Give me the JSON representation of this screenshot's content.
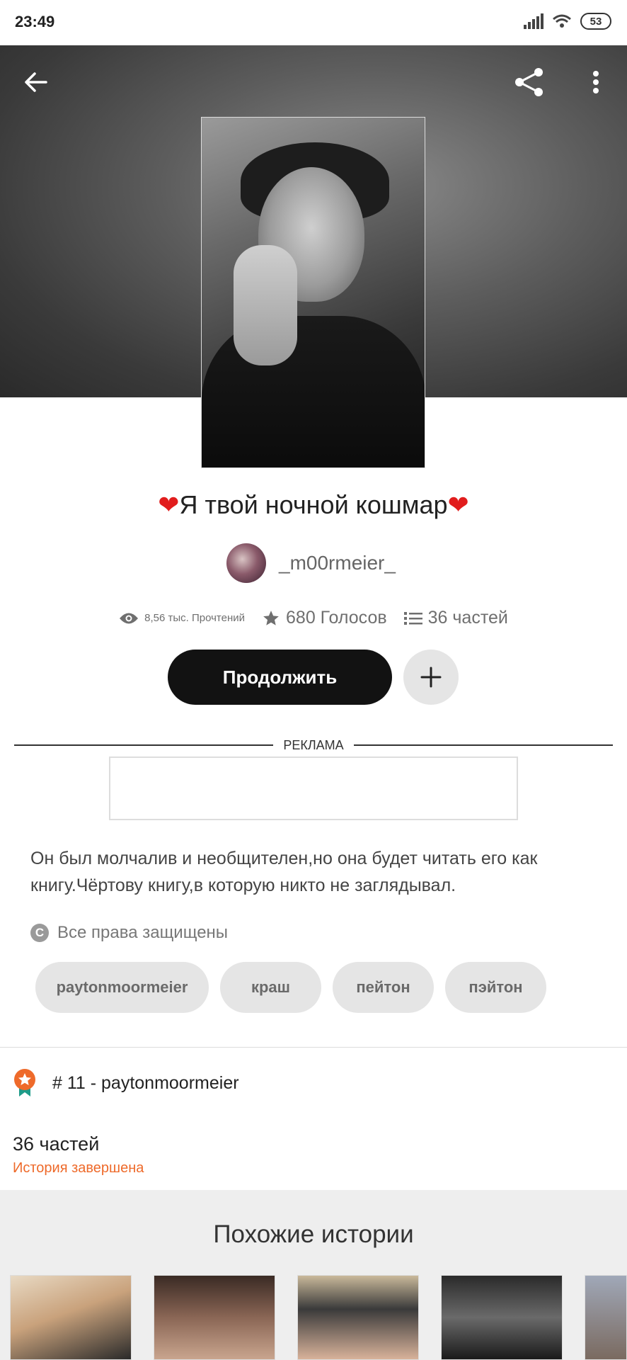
{
  "status_bar": {
    "time": "23:49",
    "battery": "53"
  },
  "header": {
    "back_icon": "arrow-left-icon",
    "share_icon": "share-icon",
    "more_icon": "more-vertical-icon"
  },
  "story": {
    "title": "Я твой ночной кошмар",
    "author": "_m00rmeier_",
    "reads": "8,56 тыс. Прочтений",
    "votes": "680 Голосов",
    "parts": "36 частей",
    "continue_label": "Продолжить",
    "ad_label": "РЕКЛАМА",
    "description": "Он был молчалив и необщителен,но она будет читать его как книгу.Чёртову книгу,в которую никто не заглядывал.",
    "rights": "Все права защищены",
    "tags": [
      "paytonmoormeier",
      "краш",
      "пейтон",
      "пэйтон"
    ],
    "ranking": "# 11 - paytonmoormeier",
    "parts_count": "36 частей",
    "status": "История завершена"
  },
  "similar": {
    "title": "Похожие истории"
  },
  "colors": {
    "accent": "#ee6a2a",
    "heart": "#e11d1d",
    "button_dark": "#121212"
  }
}
